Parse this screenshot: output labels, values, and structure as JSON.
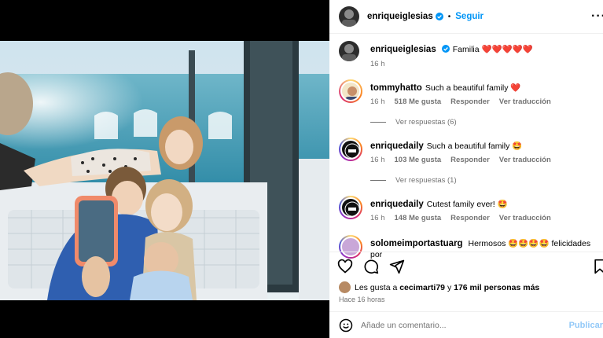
{
  "header": {
    "username": "enriqueiglesias",
    "separator": "•",
    "follow_label": "Seguir",
    "more_label": "···"
  },
  "caption": {
    "username": "enriqueiglesias",
    "text": "Familia",
    "emojis": "❤️❤️❤️❤️❤️",
    "time": "16 h"
  },
  "comments": [
    {
      "username": "tommyhatto",
      "text": "Such a beautiful family",
      "emoji": "❤️",
      "time": "16 h",
      "likes": "518 Me gusta",
      "reply": "Responder",
      "translate": "Ver traducción",
      "replies": "Ver respuestas (6)"
    },
    {
      "username": "enriquedaily",
      "text": "Such a beautiful family",
      "emoji": "🤩",
      "time": "16 h",
      "likes": "103 Me gusta",
      "reply": "Responder",
      "translate": "Ver traducción",
      "replies": "Ver respuestas (1)"
    },
    {
      "username": "enriquedaily",
      "text": "Cutest family ever!",
      "emoji": "🤩",
      "time": "16 h",
      "likes": "148 Me gusta",
      "reply": "Responder",
      "translate": "Ver traducción"
    },
    {
      "username": "solomeimportastuarg",
      "text": "Hermosos 🤩🤩🤩🤩 felicidades por"
    }
  ],
  "likes": {
    "prefix": "Les gusta a",
    "user": "cecimarti79",
    "connector": "y",
    "others": "176 mil personas más"
  },
  "time_ago": "Hace 16 horas",
  "comment_input": {
    "placeholder": "Añade un comentario...",
    "publish_label": "Publicar"
  },
  "colors": {
    "accent": "#0095f6",
    "heart": "#ed4956",
    "muted": "#737373"
  }
}
